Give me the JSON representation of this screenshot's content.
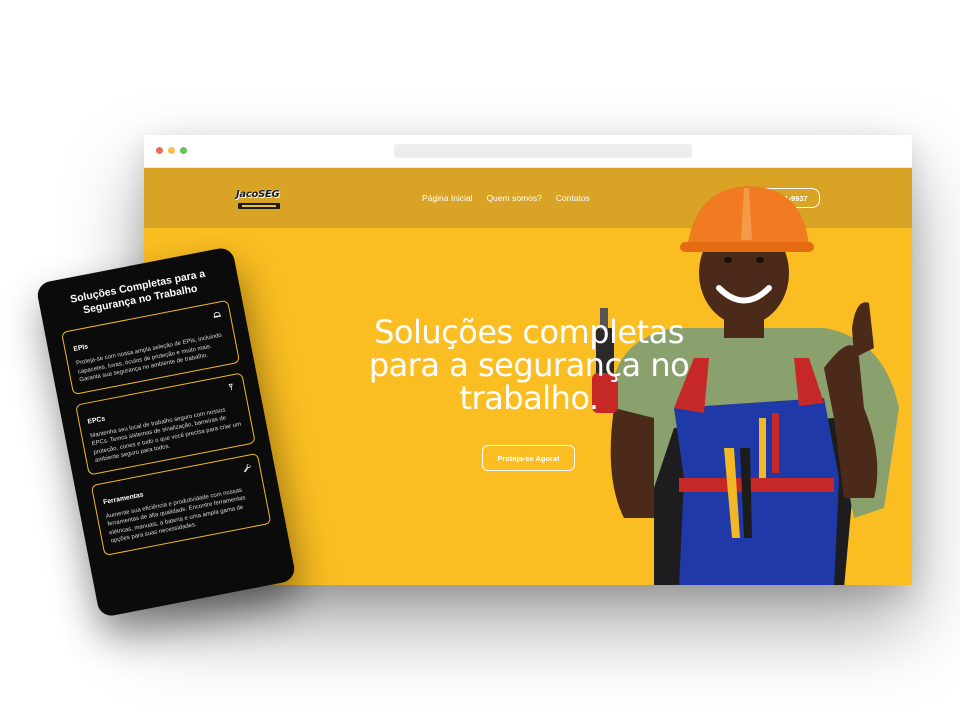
{
  "browser": {
    "url": ""
  },
  "header": {
    "logo_text": "JacoSEG",
    "nav": [
      "Página Inicial",
      "Quem somos?",
      "Contatos"
    ],
    "phone": "74 3621-9937"
  },
  "hero": {
    "title": "Soluções completas para a segurança no trabalho.",
    "cta": "Proteja-se Agora!"
  },
  "mobile": {
    "title": "Soluções Completas para a Segurança no Trabalho",
    "cards": [
      {
        "title": "EPIs",
        "icon": "helmet-icon",
        "text": "Proteja-se com nossa ampla seleção de EPIs, incluindo capacetes, luvas, óculos de proteção e muito mais. Garanta sua segurança no ambiente de trabalho."
      },
      {
        "title": "EPCs",
        "icon": "cone-icon",
        "text": "Mantenha seu local de trabalho seguro com nossos EPCs. Temos sistemas de sinalização, barreiras de proteção, cones e tudo o que você precisa para criar um ambiente seguro para todos."
      },
      {
        "title": "Ferramentas",
        "icon": "wrench-icon",
        "text": "Aumente sua eficiência e produtividade com nossas ferramentas de alta qualidade. Encontre ferramentas elétricas, manuais, a bateria e uma ampla gama de opções para suas necessidades."
      }
    ]
  },
  "colors": {
    "brand_yellow": "#fbbe22",
    "header_yellow": "#d9a325",
    "card_border": "#f2b825"
  }
}
